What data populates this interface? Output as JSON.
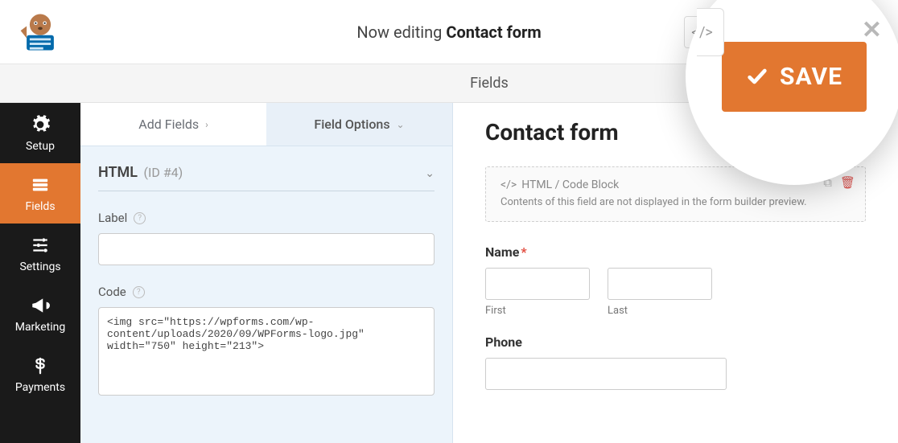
{
  "header": {
    "editing_prefix": "Now editing",
    "editing_name": "Contact form",
    "save_label": "SAVE",
    "section_title": "Fields"
  },
  "nav": {
    "items": [
      {
        "id": "setup",
        "label": "Setup",
        "icon": "gear"
      },
      {
        "id": "fields",
        "label": "Fields",
        "icon": "list"
      },
      {
        "id": "settings",
        "label": "Settings",
        "icon": "sliders"
      },
      {
        "id": "marketing",
        "label": "Marketing",
        "icon": "bullhorn"
      },
      {
        "id": "payments",
        "label": "Payments",
        "icon": "dollar"
      }
    ],
    "active_id": "fields"
  },
  "tabs": {
    "add": "Add Fields",
    "options": "Field Options"
  },
  "fieldOptions": {
    "type_label": "HTML",
    "id_label": "(ID #4)",
    "label_field": "Label",
    "label_value": "",
    "code_field": "Code",
    "code_value": "<img src=\"https://wpforms.com/wp-content/uploads/2020/09/WPForms-logo.jpg\" width=\"750\" height=\"213\">"
  },
  "preview": {
    "form_title": "Contact form",
    "html_block_title": "HTML / Code Block",
    "html_block_desc": "Contents of this field are not displayed in the form builder preview.",
    "name_label": "Name",
    "name_first_sub": "First",
    "name_last_sub": "Last",
    "phone_label": "Phone"
  }
}
